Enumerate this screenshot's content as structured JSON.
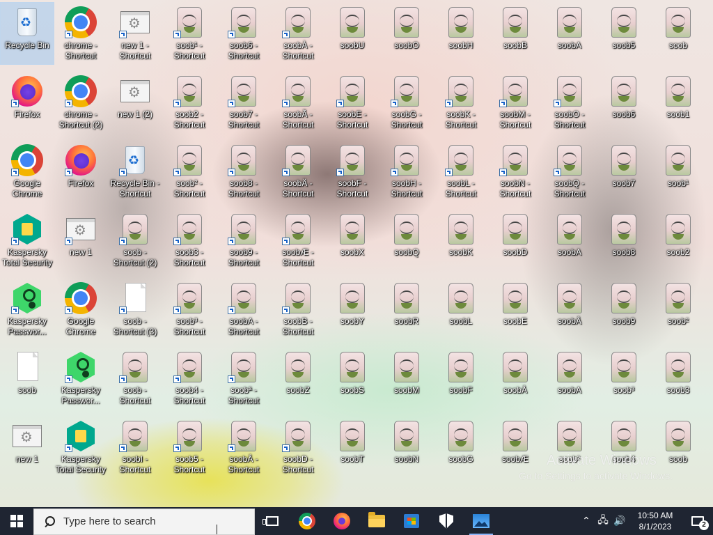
{
  "desktop": {
    "icons": [
      {
        "label": "Recycle Bin",
        "type": "recycle",
        "shortcut": false,
        "selected": true
      },
      {
        "label": "Firefox",
        "type": "firefox",
        "shortcut": true
      },
      {
        "label": "Google Chrome",
        "type": "chrome",
        "shortcut": true
      },
      {
        "label": "Kaspersky Total Security",
        "type": "kts",
        "shortcut": true
      },
      {
        "label": "Kaspersky Passwor...",
        "type": "kpm",
        "shortcut": true
      },
      {
        "label": "soob",
        "type": "file",
        "shortcut": false
      },
      {
        "label": "new 1",
        "type": "window",
        "shortcut": false
      },
      {
        "label": "chrome - Shortcut",
        "type": "chrome",
        "shortcut": true
      },
      {
        "label": "chrome - Shortcut (2)",
        "type": "chrome",
        "shortcut": true
      },
      {
        "label": "Firefox",
        "type": "firefox",
        "shortcut": true
      },
      {
        "label": "new 1",
        "type": "window",
        "shortcut": true
      },
      {
        "label": "Google Chrome",
        "type": "chrome",
        "shortcut": true
      },
      {
        "label": "Kaspersky Passwor...",
        "type": "kpm",
        "shortcut": true
      },
      {
        "label": "Kaspersky Total Security",
        "type": "kts",
        "shortcut": true
      },
      {
        "label": "new 1 - Shortcut",
        "type": "window",
        "shortcut": true
      },
      {
        "label": "new 1 (2)",
        "type": "window",
        "shortcut": false
      },
      {
        "label": "Recycle Bin - Shortcut",
        "type": "recycle",
        "shortcut": true
      },
      {
        "label": "soob - Shortcut (2)",
        "type": "soob",
        "shortcut": true
      },
      {
        "label": "soob - Shortcut (3)",
        "type": "file",
        "shortcut": true
      },
      {
        "label": "soob - Shortcut",
        "type": "soob",
        "shortcut": true
      },
      {
        "label": "soobI - Shortcut",
        "type": "soob",
        "shortcut": true
      },
      {
        "label": "soob¹ - Shortcut",
        "type": "soob",
        "shortcut": true
      },
      {
        "label": "soob2 - Shortcut",
        "type": "soob",
        "shortcut": true
      },
      {
        "label": "soob² - Shortcut",
        "type": "soob",
        "shortcut": true
      },
      {
        "label": "soob3 - Shortcut",
        "type": "soob",
        "shortcut": true
      },
      {
        "label": "soob³ - Shortcut",
        "type": "soob",
        "shortcut": true
      },
      {
        "label": "soob4 - Shortcut",
        "type": "soob",
        "shortcut": true
      },
      {
        "label": "soob5 - Shortcut",
        "type": "soob",
        "shortcut": true
      },
      {
        "label": "soob6 - Shortcut",
        "type": "soob",
        "shortcut": true
      },
      {
        "label": "soob7 - Shortcut",
        "type": "soob",
        "shortcut": true
      },
      {
        "label": "soob8 - Shortcut",
        "type": "soob",
        "shortcut": true
      },
      {
        "label": "soob9 - Shortcut",
        "type": "soob",
        "shortcut": true
      },
      {
        "label": "soobA - Shortcut",
        "type": "soob",
        "shortcut": true
      },
      {
        "label": "soobª - Shortcut",
        "type": "soob",
        "shortcut": true
      },
      {
        "label": "soobÂ - Shortcut",
        "type": "soob",
        "shortcut": true
      },
      {
        "label": "soobÀ - Shortcut",
        "type": "soob",
        "shortcut": true
      },
      {
        "label": "soobÃ - Shortcut",
        "type": "soob",
        "shortcut": true
      },
      {
        "label": "soobÄ - Shortcut",
        "type": "soob",
        "shortcut": true
      },
      {
        "label": "soobÆ - Shortcut",
        "type": "soob",
        "shortcut": true
      },
      {
        "label": "soobB - Shortcut",
        "type": "soob",
        "shortcut": true
      },
      {
        "label": "soobZ",
        "type": "soob",
        "shortcut": false
      },
      {
        "label": "soobD - Shortcut",
        "type": "soob",
        "shortcut": true
      },
      {
        "label": "soobU",
        "type": "soob",
        "shortcut": false
      },
      {
        "label": "soobE - Shortcut",
        "type": "soob",
        "shortcut": true
      },
      {
        "label": "soobF - Shortcut",
        "type": "soob",
        "shortcut": true
      },
      {
        "label": "soobX",
        "type": "soob",
        "shortcut": false
      },
      {
        "label": "soobY",
        "type": "soob",
        "shortcut": false
      },
      {
        "label": "soobS",
        "type": "soob",
        "shortcut": false
      },
      {
        "label": "soobT",
        "type": "soob",
        "shortcut": false
      },
      {
        "label": "soobO",
        "type": "soob",
        "shortcut": false
      },
      {
        "label": "soobG - Shortcut",
        "type": "soob",
        "shortcut": true
      },
      {
        "label": "soobH - Shortcut",
        "type": "soob",
        "shortcut": true
      },
      {
        "label": "soobQ",
        "type": "soob",
        "shortcut": false
      },
      {
        "label": "soobR",
        "type": "soob",
        "shortcut": false
      },
      {
        "label": "soobM",
        "type": "soob",
        "shortcut": false
      },
      {
        "label": "soobN",
        "type": "soob",
        "shortcut": false
      },
      {
        "label": "soobH",
        "type": "soob",
        "shortcut": false
      },
      {
        "label": "soobK - Shortcut",
        "type": "soob",
        "shortcut": true
      },
      {
        "label": "soobL - Shortcut",
        "type": "soob",
        "shortcut": true
      },
      {
        "label": "soobK",
        "type": "soob",
        "shortcut": false
      },
      {
        "label": "soobL",
        "type": "soob",
        "shortcut": false
      },
      {
        "label": "soobF",
        "type": "soob",
        "shortcut": false
      },
      {
        "label": "soobG",
        "type": "soob",
        "shortcut": false
      },
      {
        "label": "soobB",
        "type": "soob",
        "shortcut": false
      },
      {
        "label": "soobM - Shortcut",
        "type": "soob",
        "shortcut": true
      },
      {
        "label": "soobN - Shortcut",
        "type": "soob",
        "shortcut": true
      },
      {
        "label": "soobD",
        "type": "soob",
        "shortcut": false
      },
      {
        "label": "soobE",
        "type": "soob",
        "shortcut": false
      },
      {
        "label": "soobÅ",
        "type": "soob",
        "shortcut": false
      },
      {
        "label": "soobÆ",
        "type": "soob",
        "shortcut": false
      },
      {
        "label": "soobA",
        "type": "soob",
        "shortcut": false
      },
      {
        "label": "soobO - Shortcut",
        "type": "soob",
        "shortcut": true
      },
      {
        "label": "soobQ - Shortcut",
        "type": "soob",
        "shortcut": true
      },
      {
        "label": "soobA",
        "type": "soob",
        "shortcut": false
      },
      {
        "label": "soobÂ",
        "type": "soob",
        "shortcut": false
      },
      {
        "label": "soobA",
        "type": "soob",
        "shortcut": false
      },
      {
        "label": "soob²",
        "type": "soob",
        "shortcut": false
      },
      {
        "label": "soob5",
        "type": "soob",
        "shortcut": false
      },
      {
        "label": "soob6",
        "type": "soob",
        "shortcut": false
      },
      {
        "label": "soob7",
        "type": "soob",
        "shortcut": false
      },
      {
        "label": "soob8",
        "type": "soob",
        "shortcut": false
      },
      {
        "label": "soob9",
        "type": "soob",
        "shortcut": false
      },
      {
        "label": "soob³",
        "type": "soob",
        "shortcut": false
      },
      {
        "label": "soob4",
        "type": "soob",
        "shortcut": false
      },
      {
        "label": "soob",
        "type": "soob",
        "shortcut": false
      },
      {
        "label": "soob1",
        "type": "soob",
        "shortcut": false
      },
      {
        "label": "soob¹",
        "type": "soob",
        "shortcut": false
      },
      {
        "label": "soob2",
        "type": "soob",
        "shortcut": false
      },
      {
        "label": "soob²",
        "type": "soob",
        "shortcut": false
      },
      {
        "label": "soob3",
        "type": "soob",
        "shortcut": false
      },
      {
        "label": "soob",
        "type": "soob",
        "shortcut": false
      }
    ]
  },
  "watermark": {
    "title": "Activate Windows",
    "subtitle": "Go to Settings to activate Windows."
  },
  "taskbar": {
    "search_placeholder": "Type here to search",
    "apps": [
      {
        "name": "task-view",
        "icon": "task-view-icon"
      },
      {
        "name": "chrome",
        "icon": "chrome-icon"
      },
      {
        "name": "firefox",
        "icon": "firefox-icon"
      },
      {
        "name": "file-explorer",
        "icon": "folder-icon"
      },
      {
        "name": "microsoft-store",
        "icon": "store-icon"
      },
      {
        "name": "security",
        "icon": "shield-icon"
      },
      {
        "name": "photos",
        "icon": "photos-icon"
      }
    ],
    "tray": {
      "chevron": "^",
      "time": "10:50 AM",
      "date": "8/1/2023",
      "notification_count": "2"
    }
  },
  "colors": {
    "taskbar_bg": "#1f2532",
    "selection": "#a0c8f0"
  }
}
